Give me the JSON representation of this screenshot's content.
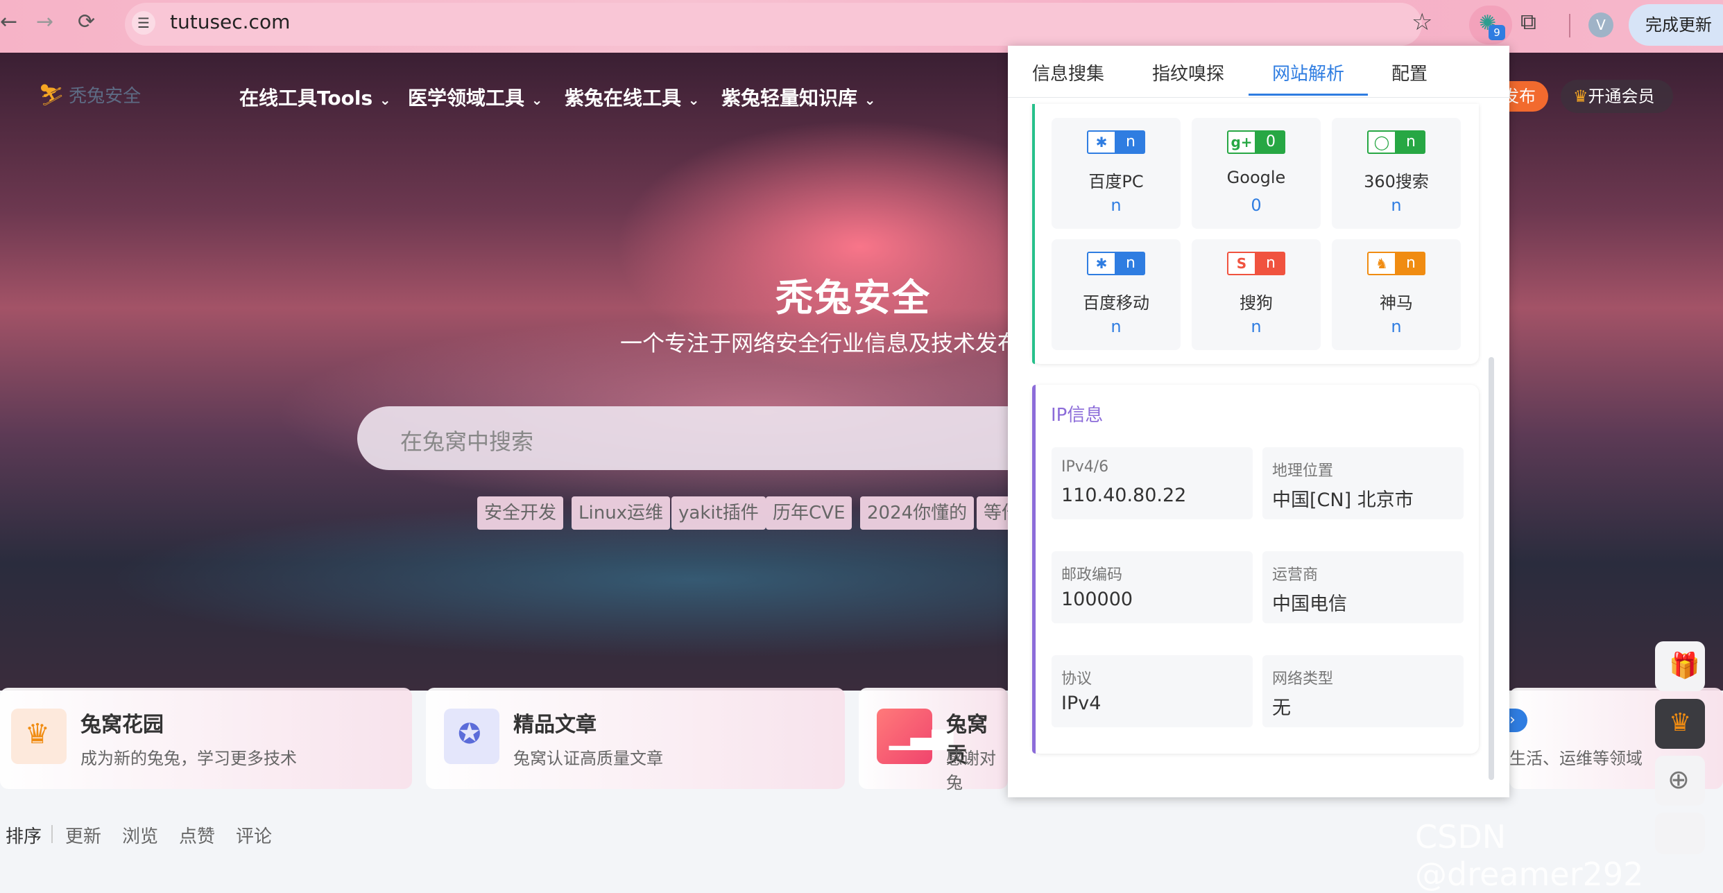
{
  "browser": {
    "url": "tutusec.com",
    "update_button": "完成更新",
    "extension_badge": "9",
    "profile_initial": "V",
    "more_glyph": "⋮"
  },
  "site": {
    "menu": [
      "在线工具Tools",
      "医学领域工具",
      "紫兔在线工具",
      "紫兔轻量知识库"
    ],
    "logo_text": "秃兔安全",
    "publish_fragment": "发布",
    "vip_button": "开通会员",
    "hero_title": "秃兔安全",
    "hero_subtitle": "一个专注于网络安全行业信息及技术发布",
    "search_placeholder": "在兔窝中搜索",
    "tags": [
      "安全开发",
      "Linux运维",
      "yakit插件",
      "历年CVE",
      "2024你懂的",
      "等倍"
    ],
    "cards": [
      {
        "title": "兔窝花园",
        "desc": "成为新的兔兔，学习更多技术"
      },
      {
        "title": "精品文章",
        "desc": "兔窝认证高质量文章"
      },
      {
        "title": "兔窝贡",
        "desc": "感谢对兔"
      },
      {
        "title": "",
        "desc": "生活、运维等领域"
      }
    ],
    "sort": {
      "label": "排序",
      "options": [
        "更新",
        "浏览",
        "点赞",
        "评论"
      ]
    },
    "watermark": "CSDN @dreamer292"
  },
  "popup": {
    "tabs": [
      "信息搜集",
      "指纹嗅探",
      "网站解析",
      "配置"
    ],
    "active_tab": "网站解析",
    "engines": [
      {
        "name": "百度PC",
        "badge_value": "n",
        "value": "n",
        "icon": "baidu-paw-icon",
        "color": "#2f7de1",
        "glyph": "🐾"
      },
      {
        "name": "Google",
        "badge_value": "0",
        "value": "0",
        "icon": "google-plus-icon",
        "color": "#27a744",
        "glyph": "g+"
      },
      {
        "name": "360搜索",
        "badge_value": "n",
        "value": "n",
        "icon": "360-search-icon",
        "color": "#27a744",
        "glyph": "Q"
      },
      {
        "name": "百度移动",
        "badge_value": "n",
        "value": "n",
        "icon": "baidu-paw-icon",
        "color": "#2f7de1",
        "glyph": "🐾"
      },
      {
        "name": "搜狗",
        "badge_value": "n",
        "value": "n",
        "icon": "sogou-icon",
        "color": "#f0533f",
        "glyph": "S"
      },
      {
        "name": "神马",
        "badge_value": "n",
        "value": "n",
        "icon": "shenma-icon",
        "color": "#f08c12",
        "glyph": "♞"
      }
    ],
    "ip_section_title": "IP信息",
    "ip_info": [
      {
        "label": "IPv4/6",
        "value": "110.40.80.22"
      },
      {
        "label": "地理位置",
        "value": "中国[CN] 北京市"
      },
      {
        "label": "邮政编码",
        "value": "100000"
      },
      {
        "label": "运营商",
        "value": "中国电信"
      },
      {
        "label": "协议",
        "value": "IPv4"
      },
      {
        "label": "网络类型",
        "value": "无"
      }
    ]
  }
}
